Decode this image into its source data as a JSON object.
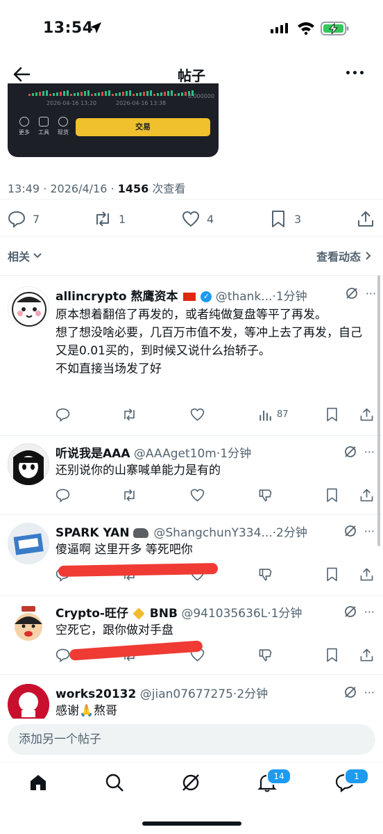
{
  "status_bar": {
    "time": "13:54"
  },
  "header": {
    "title": "帖子"
  },
  "embed": {
    "dates": [
      "2026-04-16 13:20",
      "2026-04-16 13:38"
    ],
    "zero_label": "0.000000",
    "tools": [
      "更多",
      "工具",
      "现货"
    ],
    "trade_label": "交易"
  },
  "post_meta": {
    "time": "13:49",
    "date": "2026/4/16",
    "views": "1456",
    "views_suffix": "次查看"
  },
  "post_stats": {
    "replies": "7",
    "reposts": "1",
    "likes": "4",
    "bookmarks": "3"
  },
  "filters": {
    "related": "相关",
    "activity": "查看动态"
  },
  "replies": [
    {
      "name": "allincrypto 熬鹰资本",
      "handle": "@thank...",
      "time": "1分钟",
      "text": "原本想着翻倍了再发的，或者纯做复盘等平了再发。\n想了想没啥必要，几百万市值不发，等冲上去了再发，自己又是0.01买的，到时候又说什么抬轿子。\n不如直接当场发了好",
      "views": "87"
    },
    {
      "name": "听说我是AAA",
      "handle": "@AAAget10m",
      "time": "1分钟",
      "text": "还别说你的山寨喊单能力是有的"
    },
    {
      "name": "SPARK YAN",
      "handle": "@ShangchunY334...",
      "time": "2分钟",
      "text": "傻逼啊 这里开多 等死吧你"
    },
    {
      "name": "Crypto-旺仔",
      "name_suffix": "BNB",
      "handle": "@941035636L",
      "time": "1分钟",
      "text": "空死它，跟你做对手盘"
    },
    {
      "name": "works20132",
      "handle": "@jian07677275",
      "time": "2分钟",
      "text": "感谢🙏熬哥"
    }
  ],
  "compose": {
    "placeholder": "添加另一个帖子"
  },
  "tabbar": {
    "notifications_badge": "14",
    "messages_badge": "1"
  },
  "colors": {
    "accent": "#1d9bf0",
    "muted": "#536471",
    "redact": "#ef3b34",
    "trade": "#f0c02d"
  }
}
